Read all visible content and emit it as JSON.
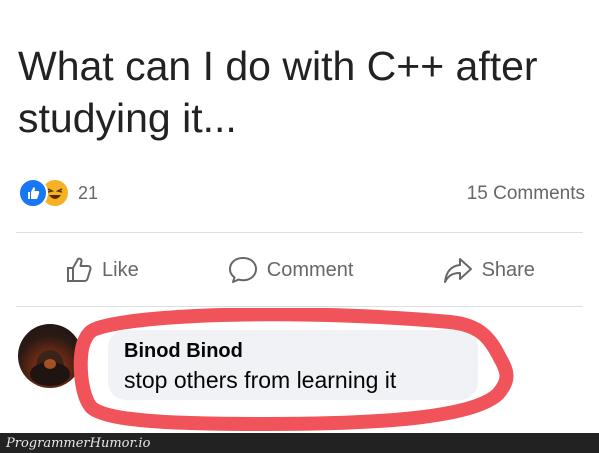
{
  "post": {
    "text": "What can I do with C++ after studying it...",
    "reaction_count": "21",
    "comments_count": "15 Comments",
    "reaction_icons": [
      "like-reaction-icon",
      "haha-reaction-icon"
    ]
  },
  "actions": {
    "like_label": "Like",
    "comment_label": "Comment",
    "share_label": "Share"
  },
  "comment": {
    "author": "Binod Binod",
    "text": "stop others from learning it",
    "highlight_color": "#f0545a"
  },
  "footer": {
    "watermark": "ProgrammerHumor.io"
  },
  "colors": {
    "like_blue": "#1877f2",
    "haha_yellow": "#f7b125",
    "muted_text": "#65676b",
    "bubble_bg": "#f0f2f5"
  }
}
